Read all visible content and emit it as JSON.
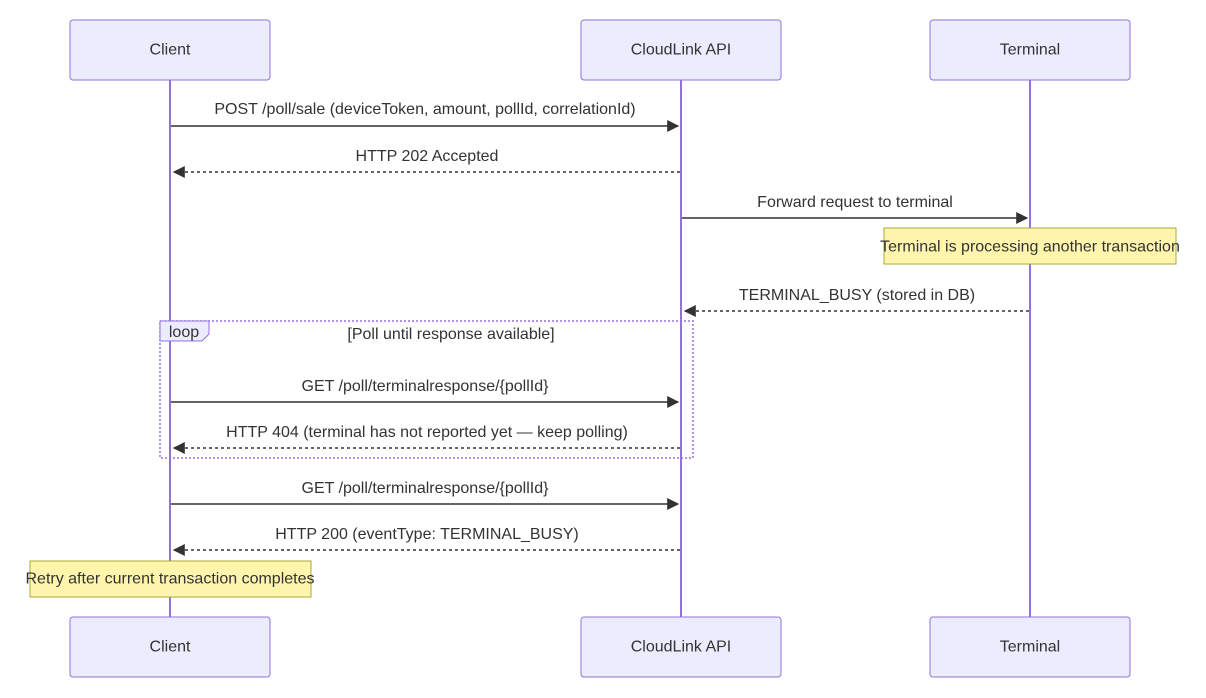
{
  "participants": [
    {
      "id": "client",
      "label": "Client"
    },
    {
      "id": "api",
      "label": "CloudLink API"
    },
    {
      "id": "terminal",
      "label": "Terminal"
    }
  ],
  "messages": [
    {
      "from": "client",
      "to": "api",
      "label": "POST /poll/sale (deviceToken, amount, pollId, correlationId)",
      "style": "solid"
    },
    {
      "from": "api",
      "to": "client",
      "label": "HTTP 202 Accepted",
      "style": "dashed"
    },
    {
      "from": "api",
      "to": "terminal",
      "label": "Forward request to terminal",
      "style": "solid"
    },
    {
      "from": "terminal",
      "to": "api",
      "label": "TERMINAL_BUSY (stored in DB)",
      "style": "dashed"
    },
    {
      "from": "client",
      "to": "api",
      "label": "GET /poll/terminalresponse/{pollId}",
      "style": "solid"
    },
    {
      "from": "api",
      "to": "client",
      "label": "HTTP 404 (terminal has not reported yet — keep polling)",
      "style": "dashed"
    },
    {
      "from": "client",
      "to": "api",
      "label": "GET /poll/terminalresponse/{pollId}",
      "style": "solid"
    },
    {
      "from": "api",
      "to": "client",
      "label": "HTTP 200 (eventType: TERMINAL_BUSY)",
      "style": "dashed"
    }
  ],
  "notes": [
    {
      "over": "terminal",
      "text": "Terminal is processing another transaction"
    },
    {
      "over": "client",
      "text": "Retry after current transaction completes"
    }
  ],
  "loop": {
    "keyword": "loop",
    "condition": "[Poll until response available]"
  }
}
